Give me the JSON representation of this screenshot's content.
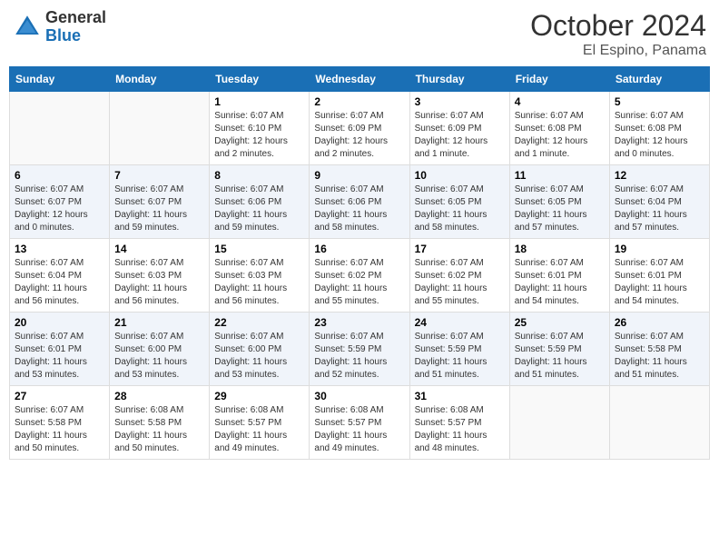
{
  "header": {
    "logo_general": "General",
    "logo_blue": "Blue",
    "month_title": "October 2024",
    "location": "El Espino, Panama"
  },
  "weekdays": [
    "Sunday",
    "Monday",
    "Tuesday",
    "Wednesday",
    "Thursday",
    "Friday",
    "Saturday"
  ],
  "weeks": [
    [
      {
        "day": "",
        "info": ""
      },
      {
        "day": "",
        "info": ""
      },
      {
        "day": "1",
        "info": "Sunrise: 6:07 AM\nSunset: 6:10 PM\nDaylight: 12 hours and 2 minutes."
      },
      {
        "day": "2",
        "info": "Sunrise: 6:07 AM\nSunset: 6:09 PM\nDaylight: 12 hours and 2 minutes."
      },
      {
        "day": "3",
        "info": "Sunrise: 6:07 AM\nSunset: 6:09 PM\nDaylight: 12 hours and 1 minute."
      },
      {
        "day": "4",
        "info": "Sunrise: 6:07 AM\nSunset: 6:08 PM\nDaylight: 12 hours and 1 minute."
      },
      {
        "day": "5",
        "info": "Sunrise: 6:07 AM\nSunset: 6:08 PM\nDaylight: 12 hours and 0 minutes."
      }
    ],
    [
      {
        "day": "6",
        "info": "Sunrise: 6:07 AM\nSunset: 6:07 PM\nDaylight: 12 hours and 0 minutes."
      },
      {
        "day": "7",
        "info": "Sunrise: 6:07 AM\nSunset: 6:07 PM\nDaylight: 11 hours and 59 minutes."
      },
      {
        "day": "8",
        "info": "Sunrise: 6:07 AM\nSunset: 6:06 PM\nDaylight: 11 hours and 59 minutes."
      },
      {
        "day": "9",
        "info": "Sunrise: 6:07 AM\nSunset: 6:06 PM\nDaylight: 11 hours and 58 minutes."
      },
      {
        "day": "10",
        "info": "Sunrise: 6:07 AM\nSunset: 6:05 PM\nDaylight: 11 hours and 58 minutes."
      },
      {
        "day": "11",
        "info": "Sunrise: 6:07 AM\nSunset: 6:05 PM\nDaylight: 11 hours and 57 minutes."
      },
      {
        "day": "12",
        "info": "Sunrise: 6:07 AM\nSunset: 6:04 PM\nDaylight: 11 hours and 57 minutes."
      }
    ],
    [
      {
        "day": "13",
        "info": "Sunrise: 6:07 AM\nSunset: 6:04 PM\nDaylight: 11 hours and 56 minutes."
      },
      {
        "day": "14",
        "info": "Sunrise: 6:07 AM\nSunset: 6:03 PM\nDaylight: 11 hours and 56 minutes."
      },
      {
        "day": "15",
        "info": "Sunrise: 6:07 AM\nSunset: 6:03 PM\nDaylight: 11 hours and 56 minutes."
      },
      {
        "day": "16",
        "info": "Sunrise: 6:07 AM\nSunset: 6:02 PM\nDaylight: 11 hours and 55 minutes."
      },
      {
        "day": "17",
        "info": "Sunrise: 6:07 AM\nSunset: 6:02 PM\nDaylight: 11 hours and 55 minutes."
      },
      {
        "day": "18",
        "info": "Sunrise: 6:07 AM\nSunset: 6:01 PM\nDaylight: 11 hours and 54 minutes."
      },
      {
        "day": "19",
        "info": "Sunrise: 6:07 AM\nSunset: 6:01 PM\nDaylight: 11 hours and 54 minutes."
      }
    ],
    [
      {
        "day": "20",
        "info": "Sunrise: 6:07 AM\nSunset: 6:01 PM\nDaylight: 11 hours and 53 minutes."
      },
      {
        "day": "21",
        "info": "Sunrise: 6:07 AM\nSunset: 6:00 PM\nDaylight: 11 hours and 53 minutes."
      },
      {
        "day": "22",
        "info": "Sunrise: 6:07 AM\nSunset: 6:00 PM\nDaylight: 11 hours and 53 minutes."
      },
      {
        "day": "23",
        "info": "Sunrise: 6:07 AM\nSunset: 5:59 PM\nDaylight: 11 hours and 52 minutes."
      },
      {
        "day": "24",
        "info": "Sunrise: 6:07 AM\nSunset: 5:59 PM\nDaylight: 11 hours and 51 minutes."
      },
      {
        "day": "25",
        "info": "Sunrise: 6:07 AM\nSunset: 5:59 PM\nDaylight: 11 hours and 51 minutes."
      },
      {
        "day": "26",
        "info": "Sunrise: 6:07 AM\nSunset: 5:58 PM\nDaylight: 11 hours and 51 minutes."
      }
    ],
    [
      {
        "day": "27",
        "info": "Sunrise: 6:07 AM\nSunset: 5:58 PM\nDaylight: 11 hours and 50 minutes."
      },
      {
        "day": "28",
        "info": "Sunrise: 6:08 AM\nSunset: 5:58 PM\nDaylight: 11 hours and 50 minutes."
      },
      {
        "day": "29",
        "info": "Sunrise: 6:08 AM\nSunset: 5:57 PM\nDaylight: 11 hours and 49 minutes."
      },
      {
        "day": "30",
        "info": "Sunrise: 6:08 AM\nSunset: 5:57 PM\nDaylight: 11 hours and 49 minutes."
      },
      {
        "day": "31",
        "info": "Sunrise: 6:08 AM\nSunset: 5:57 PM\nDaylight: 11 hours and 48 minutes."
      },
      {
        "day": "",
        "info": ""
      },
      {
        "day": "",
        "info": ""
      }
    ]
  ]
}
